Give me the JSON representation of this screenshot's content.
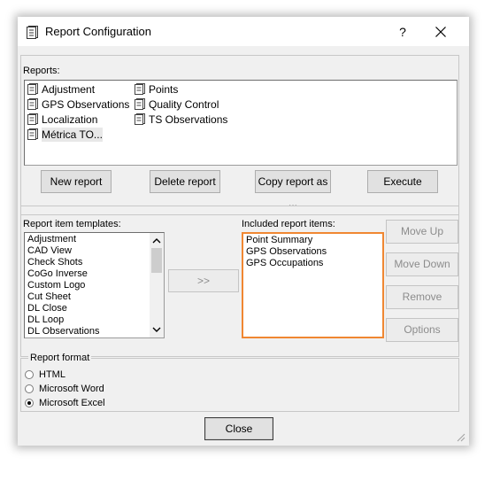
{
  "window": {
    "title": "Report Configuration",
    "help_label": "?",
    "close_label": "✕"
  },
  "reports": {
    "label": "Reports:",
    "items": [
      "Adjustment",
      "GPS Observations",
      "Localization",
      "Métrica TO...",
      "Points",
      "Quality Control",
      "TS Observations"
    ],
    "selected": "Métrica TO...",
    "buttons": {
      "new": "New report",
      "delete": "Delete report",
      "copy": "Copy report as ...",
      "execute": "Execute"
    }
  },
  "templates": {
    "label": "Report item templates:",
    "items": [
      "Adjustment",
      "CAD View",
      "Check Shots",
      "CoGo Inverse",
      "Custom Logo",
      "Cut Sheet",
      "DL Close",
      "DL Loop",
      "DL Observations"
    ],
    "add_label": ">>"
  },
  "included": {
    "label": "Included report items:",
    "items": [
      "Point Summary",
      "GPS Observations",
      "GPS Occupations"
    ],
    "highlight_color": "#f08732",
    "buttons": {
      "move_up": "Move Up",
      "move_down": "Move Down",
      "remove": "Remove",
      "options": "Options"
    }
  },
  "format": {
    "label": "Report format",
    "options": [
      "HTML",
      "Microsoft Word",
      "Microsoft Excel"
    ],
    "selected": "Microsoft Excel"
  },
  "close_button": "Close"
}
